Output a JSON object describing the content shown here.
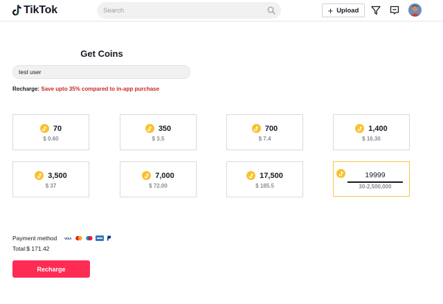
{
  "header": {
    "logo_text": "TikTok",
    "search_placeholder": "Search",
    "upload_label": "Upload",
    "upload_plus": "+"
  },
  "main": {
    "title": "Get Coins",
    "username_value": "test user",
    "recharge_label": "Recharge:",
    "recharge_promo": "Save upto 35% compared to in-app purchase",
    "packages": [
      {
        "coins": "70",
        "price": "$ 0.60"
      },
      {
        "coins": "350",
        "price": "$ 3.5"
      },
      {
        "coins": "700",
        "price": "$ 7.4"
      },
      {
        "coins": "1,400",
        "price": "$ 16.30"
      },
      {
        "coins": "3,500",
        "price": "$ 37"
      },
      {
        "coins": "7,000",
        "price": "$ 72.00"
      },
      {
        "coins": "17,500",
        "price": "$ 185.5"
      }
    ],
    "custom": {
      "value": "19999",
      "range": "30-2,500,000"
    },
    "payment_label": "Payment method",
    "payment_methods": [
      "VISA",
      "mastercard",
      "maestro",
      "amex",
      "PayPal"
    ],
    "total": "Total:$ 171.42",
    "recharge_button": "Recharge"
  },
  "colors": {
    "accent": "#fe2c55",
    "promo": "#c62828",
    "coin": "#fbc02d",
    "selected_border": "#f5c542"
  }
}
